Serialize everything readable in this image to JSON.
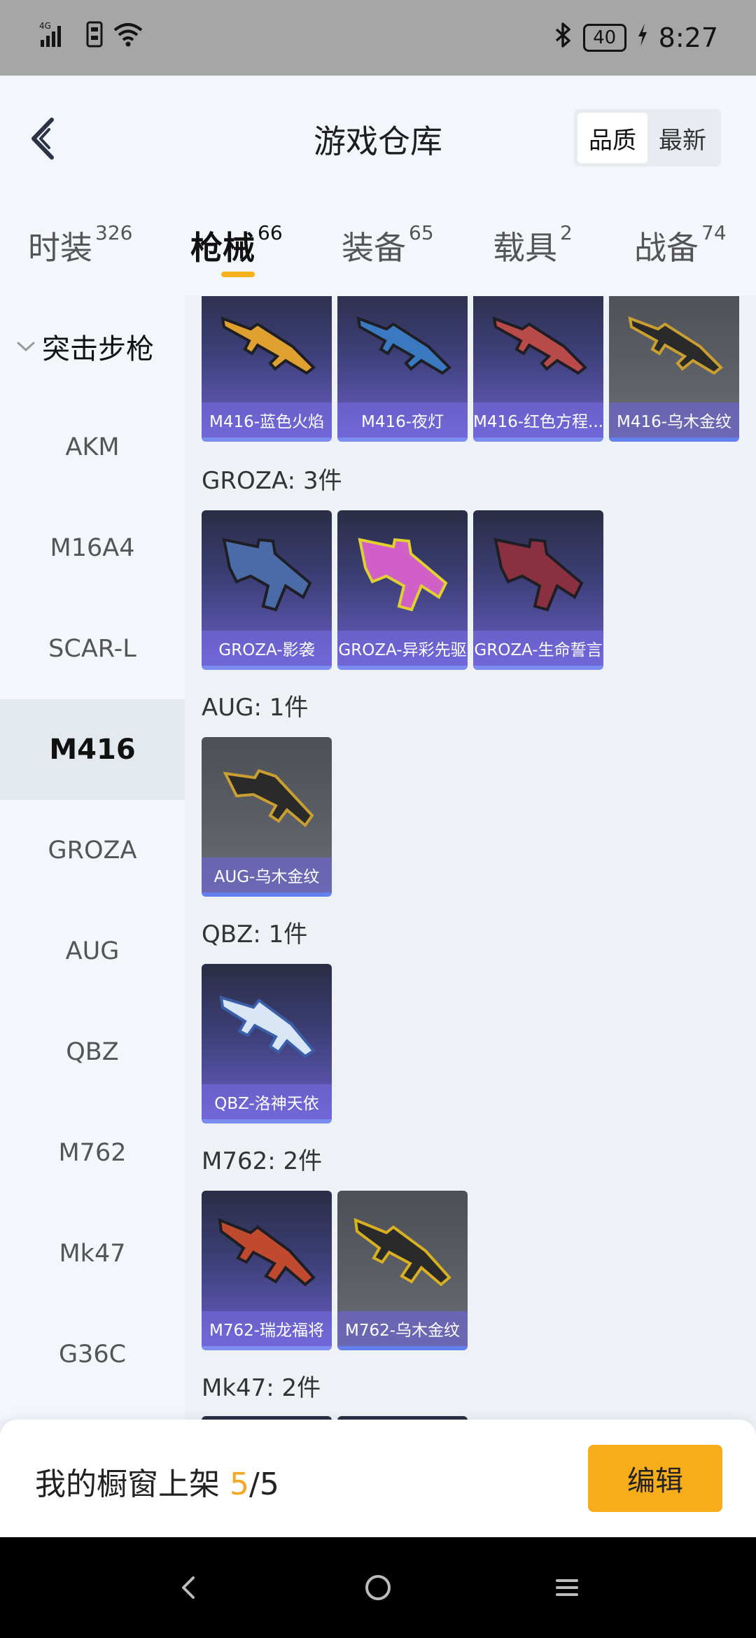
{
  "status_bar": {
    "network": "4G",
    "battery": "40",
    "time": "8:27"
  },
  "header": {
    "title": "游戏仓库",
    "sort_options": [
      "品质",
      "最新"
    ],
    "sort_selected": "品质"
  },
  "tabs": [
    {
      "label": "时装",
      "count": "326"
    },
    {
      "label": "枪械",
      "count": "66",
      "active": true
    },
    {
      "label": "装备",
      "count": "65"
    },
    {
      "label": "载具",
      "count": "2"
    },
    {
      "label": "战备",
      "count": "74"
    }
  ],
  "sidebar": {
    "category": "突击步枪",
    "items": [
      "AKM",
      "M16A4",
      "SCAR-L",
      "M416",
      "GROZA",
      "AUG",
      "QBZ",
      "M762",
      "Mk47",
      "G36C"
    ],
    "selected": "M416"
  },
  "content": {
    "m416_items": [
      "M416-蓝色火焰",
      "M416-夜灯",
      "M416-红色方程...",
      "M416-乌木金纹"
    ],
    "groups": [
      {
        "title": "GROZA: 3件",
        "items": [
          "GROZA-影袭",
          "GROZA-异彩先驱",
          "GROZA-生命誓言"
        ]
      },
      {
        "title": "AUG: 1件",
        "items": [
          "AUG-乌木金纹"
        ]
      },
      {
        "title": "QBZ: 1件",
        "items": [
          "QBZ-洛神天依"
        ]
      },
      {
        "title": "M762: 2件",
        "items": [
          "M762-瑞龙福将",
          "M762-乌木金纹"
        ]
      },
      {
        "title": "Mk47: 2件",
        "items": []
      }
    ]
  },
  "bottom_bar": {
    "showcase_label": "我的橱窗上架",
    "showcase_current": "5",
    "showcase_total": "/5",
    "edit_label": "编辑"
  },
  "colors": {
    "accent": "#f7ac1a",
    "card_purple": "#6a5fc7",
    "card_gray": "#5c5e66"
  }
}
